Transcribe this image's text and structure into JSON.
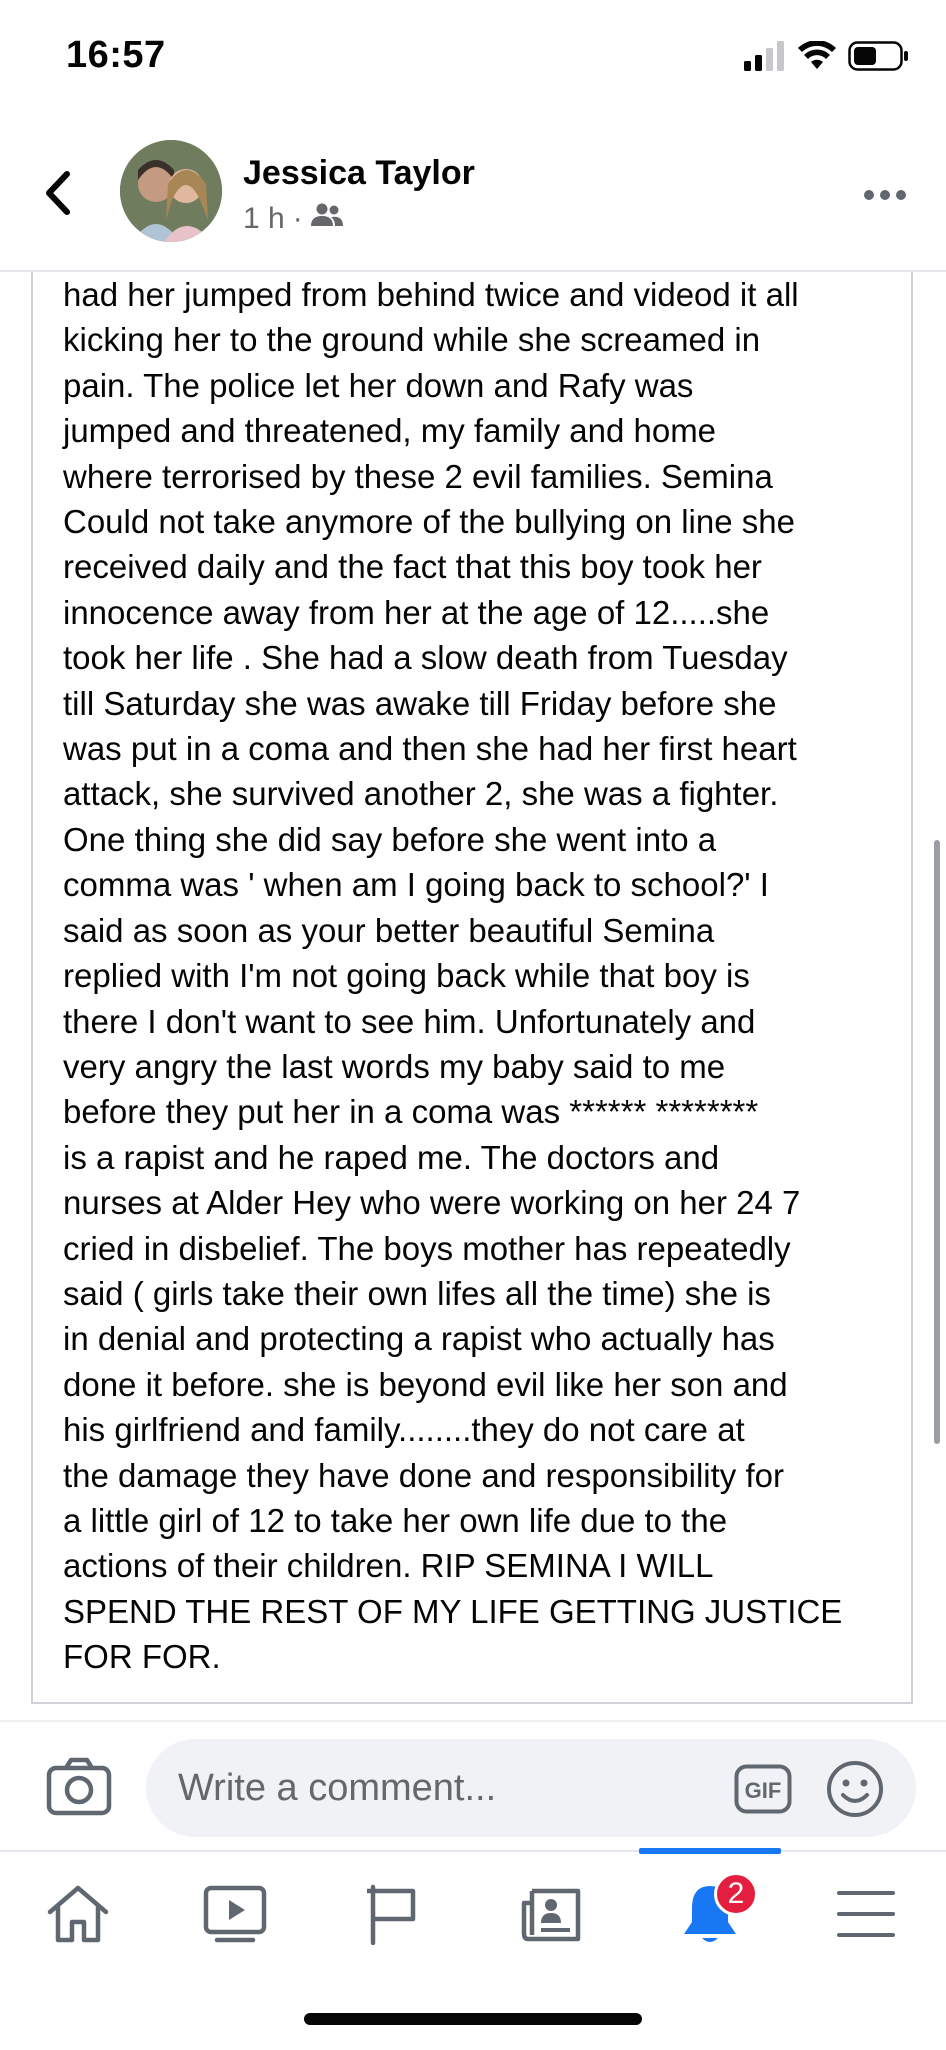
{
  "status_bar": {
    "time": "16:57"
  },
  "post": {
    "author": "Jessica Taylor",
    "time_ago": "1 h",
    "separator": "·",
    "audience_icon": "friends-icon",
    "body": "had her jumped from behind twice and videod it all\nkicking her to the ground while she screamed in\npain. The police let her down and Rafy was\njumped and threatened, my family and home\nwhere terrorised by these 2 evil families. Semina\nCould not take anymore of the bullying on line she\nreceived daily and the fact that this boy took her\ninnocence away from her at the age of 12.....she\ntook her life . She had a slow death from Tuesday\ntill Saturday she was awake till Friday before she\nwas put in a coma and then she had her first heart\nattack,  she survived another 2, she was a fighter.\nOne thing she did say before she went into a\ncomma was ' when am I going back to school?' I\nsaid as soon as your better beautiful Semina\nreplied with I'm not going back while that boy is\nthere I don't want to see him. Unfortunately and\nvery angry  the last words my baby said to me\nbefore they put her in a coma was ****** ********\nis a rapist and he raped me. The doctors and\nnurses at Alder Hey who were working on her 24 7\ncried in disbelief.  The boys mother has repeatedly\nsaid ( girls take their own lifes all the time) she is\nin denial and protecting a rapist who actually has\ndone it before. she is beyond evil like her son and\nhis girlfriend and family........they do not care at\nthe damage they have done and responsibility for\na little girl of 12 to take her own life due to the\nactions of their children. RIP SEMINA I WILL\nSPEND THE REST OF MY LIFE GETTING JUSTICE\nFOR FOR."
  },
  "comment_bar": {
    "placeholder": "Write a comment...",
    "gif_label": "GIF"
  },
  "tab_bar": {
    "tabs": [
      {
        "name": "home",
        "icon": "home-icon"
      },
      {
        "name": "watch",
        "icon": "video-icon"
      },
      {
        "name": "pages",
        "icon": "flag-icon"
      },
      {
        "name": "news",
        "icon": "news-icon"
      },
      {
        "name": "notifications",
        "icon": "bell-icon",
        "active": true,
        "badge": "2"
      },
      {
        "name": "menu",
        "icon": "menu-icon"
      }
    ],
    "notifications_badge": "2"
  },
  "colors": {
    "accent": "#1877f2",
    "badge": "#e41e3f",
    "muted_text": "#65676b",
    "icon_gray": "#606770"
  }
}
